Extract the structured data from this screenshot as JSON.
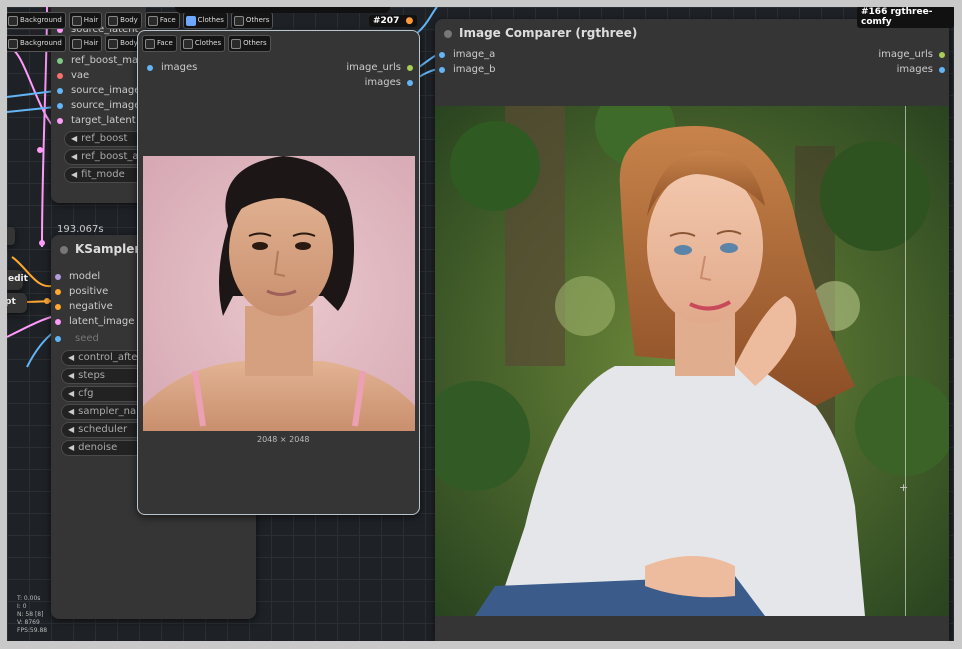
{
  "filter_bar": {
    "chips": [
      "Background",
      "Hair",
      "Body",
      "Face",
      "Clothes",
      "Others"
    ]
  },
  "node_left": {
    "inputs": [
      "source_latent",
      "ref_boost_mask",
      "vae",
      "source_image",
      "source_image_b",
      "target_latent"
    ],
    "widgets": [
      "ref_boost",
      "ref_boost_a",
      "fit_mode"
    ]
  },
  "ksampler": {
    "timing": "193.067s",
    "title": "KSampler",
    "inputs": [
      "model",
      "positive",
      "negative",
      "latent_image",
      "seed"
    ],
    "widgets": [
      "control_after_ge",
      "steps",
      "cfg",
      "sampler_name",
      "scheduler",
      "denoise"
    ]
  },
  "preview_node": {
    "badge": "#207",
    "badge_icon": "fox-icon",
    "input": "images",
    "outputs": [
      "image_urls",
      "images"
    ],
    "dimensions": "2048 × 2048"
  },
  "comparer": {
    "badge": "#166 rgthree-comfy",
    "title": "Image Comparer (rgthree)",
    "inputs": [
      "image_a",
      "image_b"
    ],
    "outputs": [
      "image_urls",
      "images"
    ]
  },
  "side_fragments": {
    "edit": "edit",
    "pt": "pt"
  },
  "stats": {
    "t": "T: 0.00s",
    "i": "I: 0",
    "n": "N: 58 [8]",
    "v": "V: 8769",
    "fps": "FPS:59.88"
  },
  "colors": {
    "model": "#b39ddb",
    "conditioning": "#ffa931",
    "latent": "#ff9cf9",
    "image": "#64b5f6",
    "vae": "#ff6e6e",
    "mask": "#81c784",
    "string": "#aacc55"
  }
}
